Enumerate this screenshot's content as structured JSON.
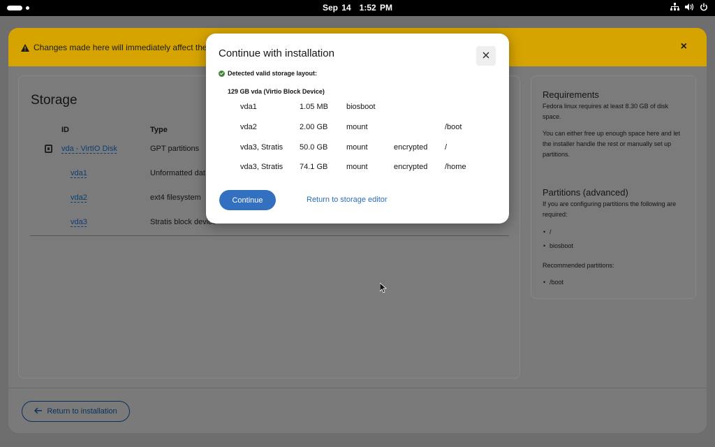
{
  "topbar": {
    "date": "Sep 14",
    "time": "1:52 PM",
    "icons": [
      "network-icon",
      "volume-icon",
      "power-icon"
    ]
  },
  "banner": {
    "text": "Changes made here will immediately affect the syst",
    "close": "×"
  },
  "storage": {
    "title": "Storage",
    "columns": {
      "id": "ID",
      "type": "Type"
    },
    "rows": [
      {
        "id": "vda - VirtIO Disk",
        "type": "GPT partitions"
      },
      {
        "id": "vda1",
        "type": "Unformatted dat"
      },
      {
        "id": "vda2",
        "type": "ext4 filesystem"
      },
      {
        "id": "vda3",
        "type": "Stratis block device"
      }
    ]
  },
  "requirements": {
    "title": "Requirements",
    "text1": "Fedora linux requires at least 8.30 GB of disk space.",
    "text2": "You can either free up enough space here and let the installer handle the rest or manually set up partitions.",
    "partitions_title": "Partitions (advanced)",
    "partitions_text": "If you are configuring partitions the following are required:",
    "required": [
      "/",
      "biosboot"
    ],
    "recommended_label": "Recommended partitions:",
    "recommended": [
      "/boot"
    ]
  },
  "footer": {
    "return_label": "Return to installation"
  },
  "modal": {
    "title": "Continue with installation",
    "status": "Detected valid storage layout:",
    "device": "129 GB vda (Virtio Block Device)",
    "partitions": [
      {
        "name": "vda1",
        "size": "1.05 MB",
        "type": "biosboot",
        "encryption": "",
        "mount": ""
      },
      {
        "name": "vda2",
        "size": "2.00 GB",
        "type": "mount",
        "encryption": "",
        "mount": "/boot"
      },
      {
        "name": "vda3, Stratis",
        "size": "50.0 GB",
        "type": "mount",
        "encryption": "encrypted",
        "mount": "/"
      },
      {
        "name": "vda3, Stratis",
        "size": "74.1 GB",
        "type": "mount",
        "encryption": "encrypted",
        "mount": "/home"
      }
    ],
    "continue_label": "Continue",
    "return_label": "Return to storage editor"
  },
  "colors": {
    "primary": "#3470c0",
    "link": "#2a6ebb",
    "warning": "#d6a400",
    "success": "#3e8635"
  }
}
